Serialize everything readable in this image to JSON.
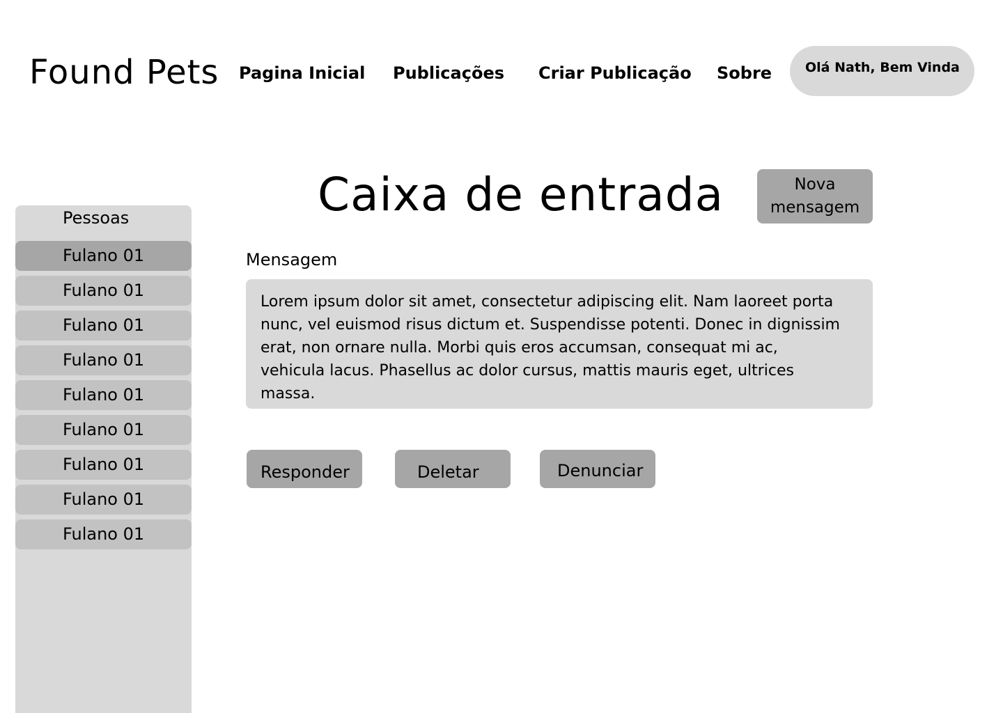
{
  "header": {
    "logo": "Found Pets",
    "nav": {
      "home": "Pagina Inicial",
      "posts": "Publicações",
      "create_post": "Criar Publicação",
      "about": "Sobre"
    },
    "greeting": "Olá Nath, Bem Vinda"
  },
  "sidebar": {
    "title": "Pessoas",
    "items": [
      {
        "label": "Fulano 01",
        "selected": true
      },
      {
        "label": "Fulano 01",
        "selected": false
      },
      {
        "label": "Fulano 01",
        "selected": false
      },
      {
        "label": "Fulano 01",
        "selected": false
      },
      {
        "label": "Fulano 01",
        "selected": false
      },
      {
        "label": "Fulano 01",
        "selected": false
      },
      {
        "label": "Fulano 01",
        "selected": false
      },
      {
        "label": "Fulano 01",
        "selected": false
      },
      {
        "label": "Fulano 01",
        "selected": false
      }
    ]
  },
  "main": {
    "title": "Caixa de entrada",
    "new_message_button": "Nova mensagem",
    "message_label": "Mensagem",
    "message_body": "Lorem ipsum dolor sit amet, consectetur adipiscing elit. Nam laoreet porta nunc, vel euismod risus dictum et. Suspendisse potenti. Donec in dignissim erat, non ornare nulla. Morbi quis eros accumsan, consequat mi ac, vehicula lacus. Phasellus ac dolor cursus, mattis mauris eget, ultrices massa.",
    "actions": {
      "reply": "Responder",
      "delete": "Deletar",
      "report": "Denunciar"
    }
  },
  "colors": {
    "panel": "#d9d9d9",
    "item": "#c2c2c2",
    "selected_item": "#a6a6a6",
    "button": "#a6a6a6"
  }
}
